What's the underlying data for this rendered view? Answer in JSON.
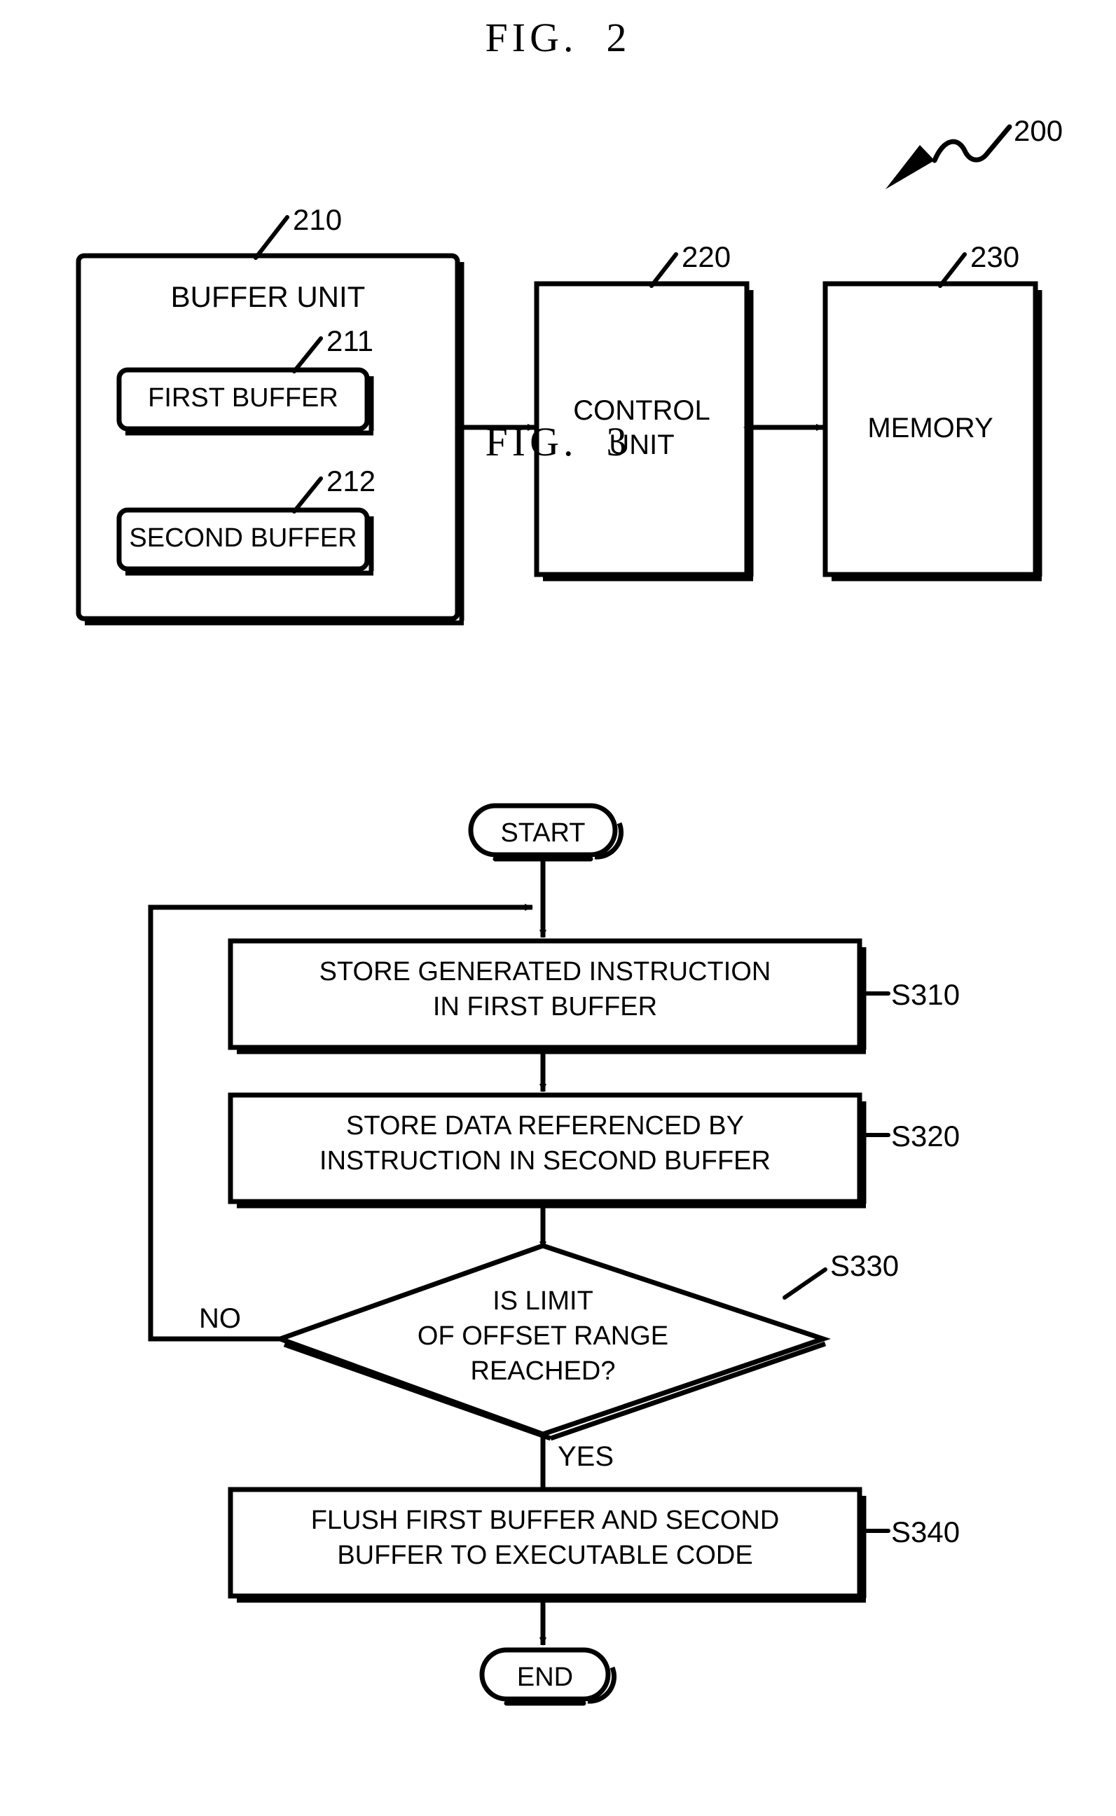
{
  "sheet": {
    "background": "#ffffff",
    "ink": "#000000"
  },
  "figures": [
    {
      "id": "fig2",
      "title": "FIG.  2",
      "system_ref": "200",
      "blocks": [
        {
          "id": "buffer-unit",
          "label": "BUFFER UNIT",
          "ref": "210"
        },
        {
          "id": "first-buffer",
          "label": "FIRST BUFFER",
          "ref": "211"
        },
        {
          "id": "second-buffer",
          "label": "SECOND BUFFER",
          "ref": "212"
        },
        {
          "id": "control-unit",
          "label": "CONTROL\nUNIT",
          "ref": "220"
        },
        {
          "id": "memory",
          "label": "MEMORY",
          "ref": "230"
        }
      ],
      "connectors": [
        {
          "from": "buffer-unit",
          "to": "control-unit",
          "type": "double-arrow"
        },
        {
          "from": "control-unit",
          "to": "memory",
          "type": "double-arrow"
        }
      ]
    },
    {
      "id": "fig3",
      "title": "FIG.  3",
      "nodes": [
        {
          "id": "start",
          "shape": "terminator",
          "label": "START",
          "ref": ""
        },
        {
          "id": "s310",
          "shape": "process",
          "label": "STORE GENERATED INSTRUCTION\nIN FIRST BUFFER",
          "ref": "S310"
        },
        {
          "id": "s320",
          "shape": "process",
          "label": "STORE DATA REFERENCED BY\nINSTRUCTION IN SECOND BUFFER",
          "ref": "S320"
        },
        {
          "id": "s330",
          "shape": "decision",
          "label": "IS LIMIT\nOF OFFSET RANGE\nREACHED?",
          "ref": "S330"
        },
        {
          "id": "s340",
          "shape": "process",
          "label": "FLUSH FIRST BUFFER AND SECOND\nBUFFER TO EXECUTABLE CODE",
          "ref": "S340"
        },
        {
          "id": "end",
          "shape": "terminator",
          "label": "END",
          "ref": ""
        }
      ],
      "branch_labels": {
        "no": "NO",
        "yes": "YES"
      }
    }
  ],
  "fig2": {
    "title": "FIG.  2",
    "system_ref": "200",
    "buffer_unit_label": "BUFFER UNIT",
    "buffer_unit_ref": "210",
    "first_buffer_label": "FIRST BUFFER",
    "first_buffer_ref": "211",
    "second_buffer_label": "SECOND BUFFER",
    "second_buffer_ref": "212",
    "control_unit_line1": "CONTROL",
    "control_unit_line2": "UNIT",
    "control_unit_ref": "220",
    "memory_label": "MEMORY",
    "memory_ref": "230"
  },
  "fig3": {
    "title": "FIG.  3",
    "start_label": "START",
    "s310_line1": "STORE GENERATED INSTRUCTION",
    "s310_line2": "IN FIRST BUFFER",
    "s310_ref": "S310",
    "s320_line1": "STORE DATA REFERENCED BY",
    "s320_line2": "INSTRUCTION IN SECOND BUFFER",
    "s320_ref": "S320",
    "s330_line1": "IS LIMIT",
    "s330_line2": "OF OFFSET RANGE",
    "s330_line3": "REACHED?",
    "s330_ref": "S330",
    "s340_line1": "FLUSH FIRST BUFFER AND SECOND",
    "s340_line2": "BUFFER TO EXECUTABLE CODE",
    "s340_ref": "S340",
    "end_label": "END",
    "no_label": "NO",
    "yes_label": "YES"
  }
}
